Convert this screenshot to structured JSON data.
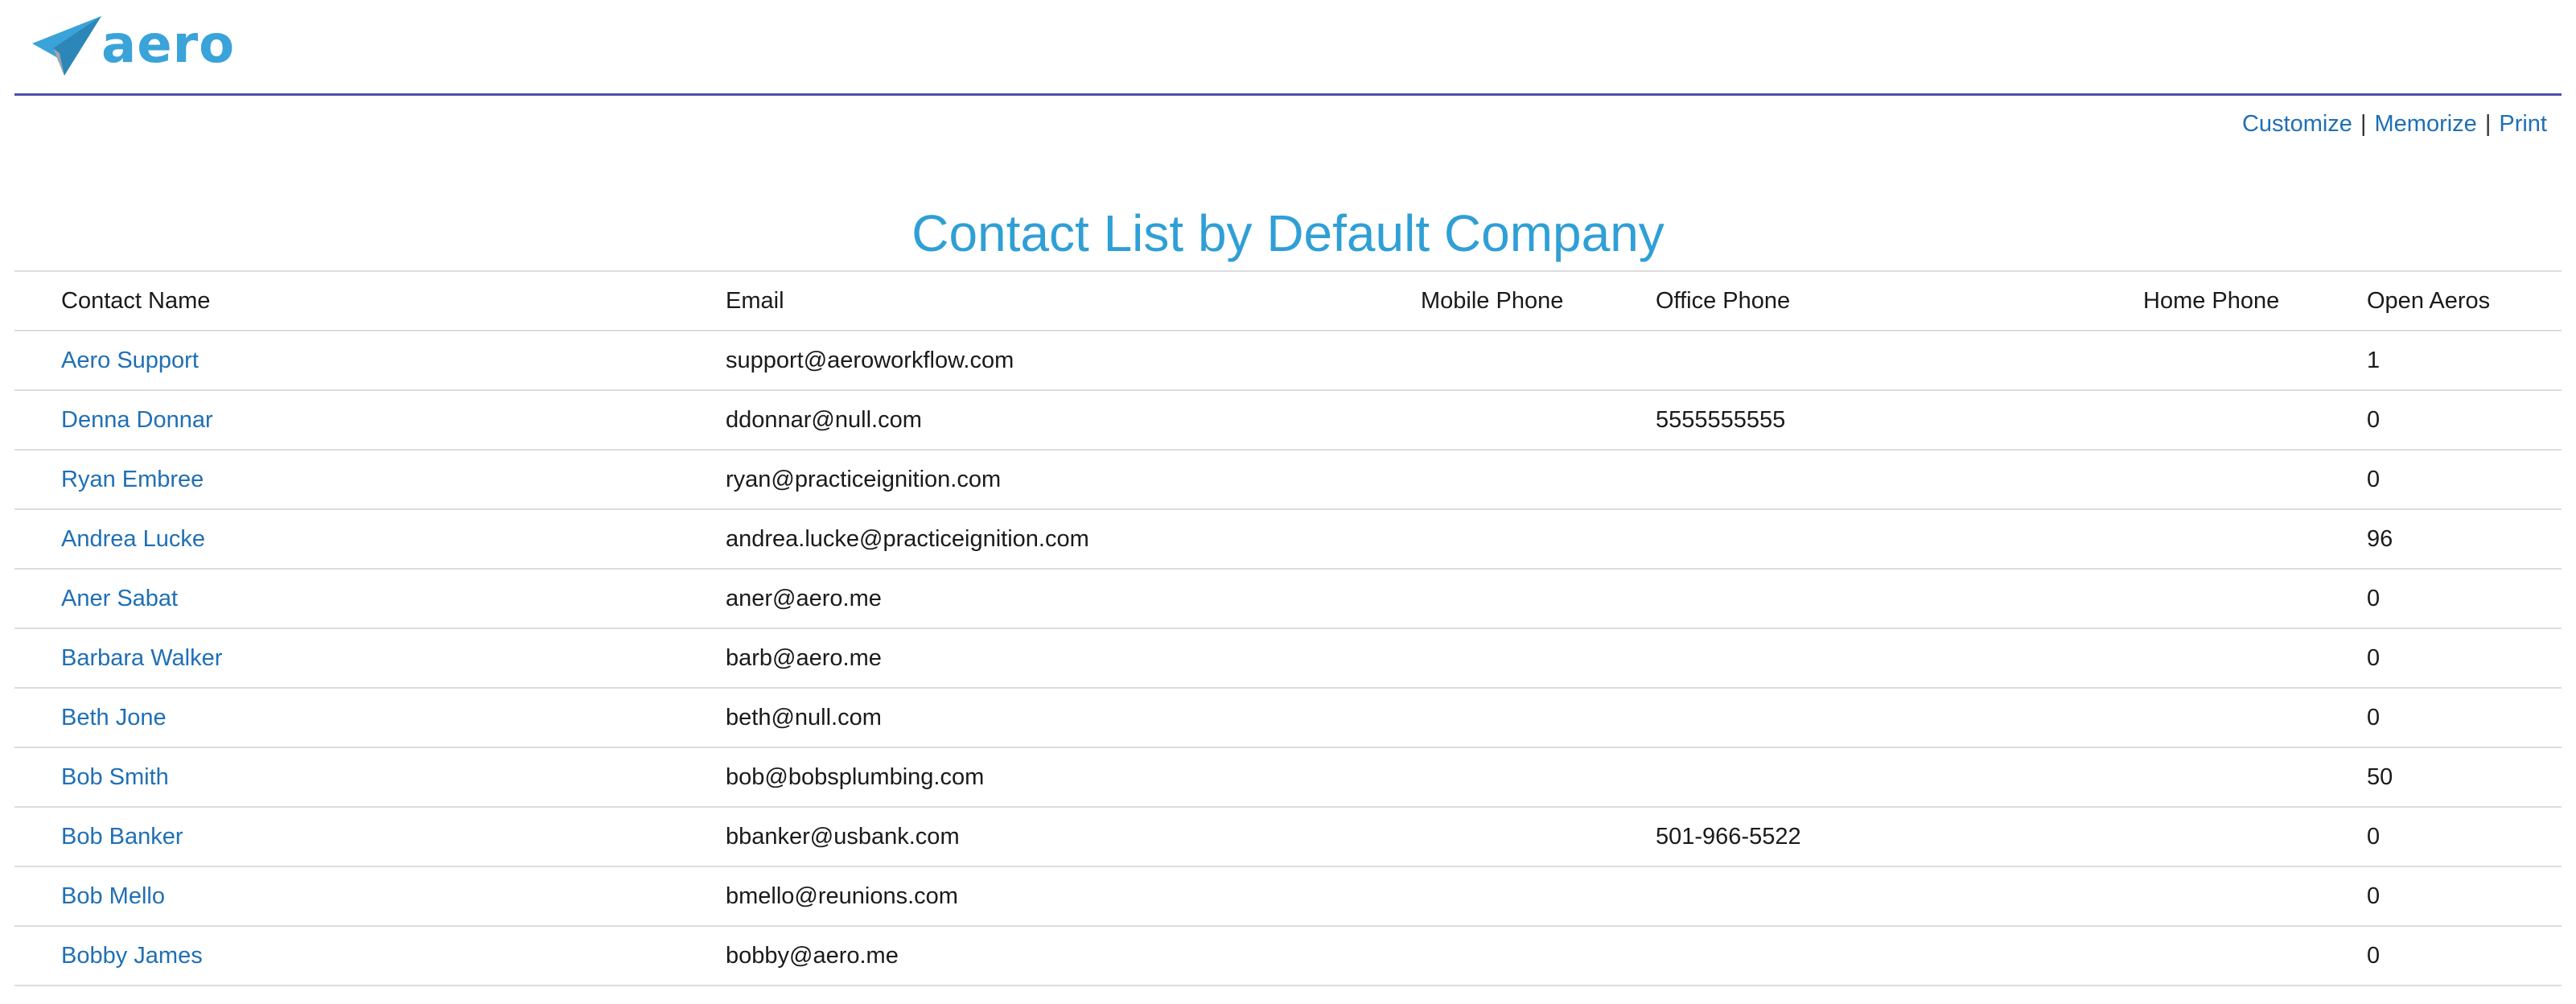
{
  "brand": {
    "name": "aero",
    "accent_color": "#3aa3d9",
    "icon": "paper-plane-icon"
  },
  "actions": {
    "customize": "Customize",
    "memorize": "Memorize",
    "print": "Print",
    "separator": "|"
  },
  "page_title": "Contact List by Default Company",
  "table": {
    "columns": {
      "name": "Contact Name",
      "email": "Email",
      "mobile": "Mobile Phone",
      "office": "Office Phone",
      "home": "Home Phone",
      "open": "Open Aeros"
    },
    "rows": [
      {
        "name": "Aero Support",
        "email": "support@aeroworkflow.com",
        "mobile": "",
        "office": "",
        "home": "",
        "open": "1"
      },
      {
        "name": "Denna Donnar",
        "email": "ddonnar@null.com",
        "mobile": "",
        "office": "5555555555",
        "home": "",
        "open": "0"
      },
      {
        "name": "Ryan Embree",
        "email": "ryan@practiceignition.com",
        "mobile": "",
        "office": "",
        "home": "",
        "open": "0"
      },
      {
        "name": "Andrea Lucke",
        "email": "andrea.lucke@practiceignition.com",
        "mobile": "",
        "office": "",
        "home": "",
        "open": "96"
      },
      {
        "name": "Aner Sabat",
        "email": "aner@aero.me",
        "mobile": "",
        "office": "",
        "home": "",
        "open": "0"
      },
      {
        "name": "Barbara Walker",
        "email": "barb@aero.me",
        "mobile": "",
        "office": "",
        "home": "",
        "open": "0"
      },
      {
        "name": "Beth Jone",
        "email": "beth@null.com",
        "mobile": "",
        "office": "",
        "home": "",
        "open": "0"
      },
      {
        "name": "Bob Smith",
        "email": "bob@bobsplumbing.com",
        "mobile": "",
        "office": "",
        "home": "",
        "open": "50"
      },
      {
        "name": "Bob Banker",
        "email": "bbanker@usbank.com",
        "mobile": "",
        "office": "501-966-5522",
        "home": "",
        "open": "0"
      },
      {
        "name": "Bob Mello",
        "email": "bmello@reunions.com",
        "mobile": "",
        "office": "",
        "home": "",
        "open": "0"
      },
      {
        "name": "Bobby James",
        "email": "bobby@aero.me",
        "mobile": "",
        "office": "",
        "home": "",
        "open": "0"
      }
    ]
  }
}
